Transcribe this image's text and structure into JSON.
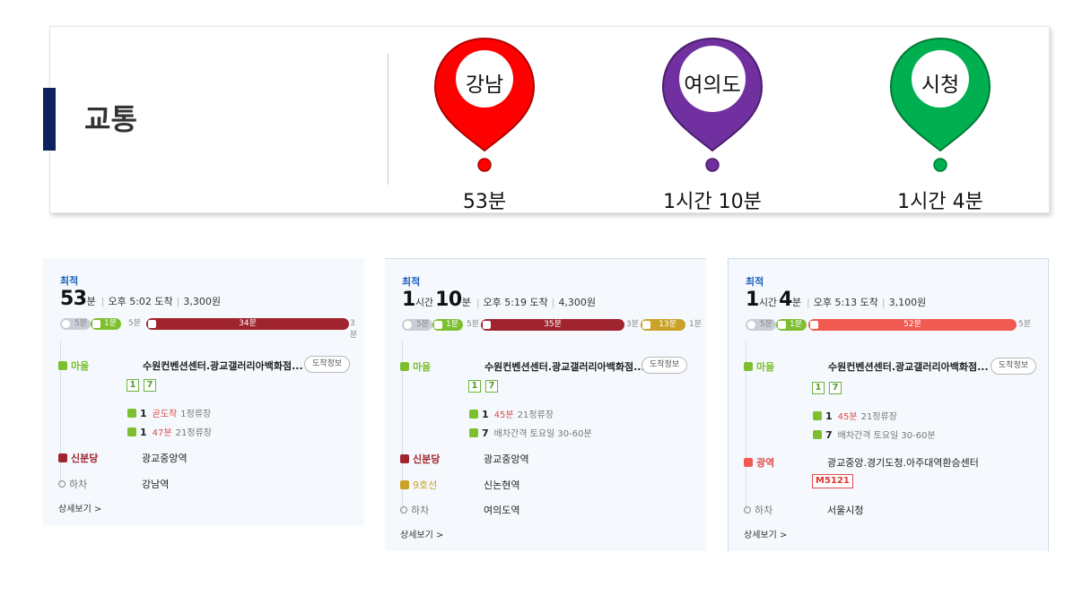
{
  "header": {
    "title": "교통"
  },
  "destinations": [
    {
      "name": "강남",
      "time": "53분",
      "color": "#ff0000",
      "dark": "#b00000"
    },
    {
      "name": "여의도",
      "time": "1시간 10분",
      "color": "#7030a0",
      "dark": "#4a1d6e"
    },
    {
      "name": "시청",
      "time": "1시간 4분",
      "color": "#00b050",
      "dark": "#007a36"
    }
  ],
  "common": {
    "best_label": "최적",
    "arrival_info": "도착정보",
    "more": "상세보기 >",
    "alight": "하차",
    "start_badge": "마을",
    "start_stop": "수원컨벤션센터.광교갤러리아백화점...",
    "routes": [
      "1",
      "7"
    ],
    "walk_first": "5분",
    "bus_first": "1분",
    "walk_second": "5분"
  },
  "cards": [
    {
      "summary": {
        "big1": "53",
        "unit1": "분",
        "big2": "",
        "unit2": "",
        "arrival": "오후 5:02 도착",
        "fare": "3,300원"
      },
      "bar": {
        "main": "34분",
        "tail": "3분",
        "transfer": ""
      },
      "buses": [
        {
          "num": "1",
          "status": "곧도착",
          "stops": "1정류장"
        },
        {
          "num": "1",
          "status": "47분",
          "stops": "21정류장"
        }
      ],
      "transfer": {
        "badge": "신분당",
        "name": "광교중앙역"
      },
      "transfer2": {
        "badge": "",
        "name": ""
      },
      "end": "강남역"
    },
    {
      "summary": {
        "big1": "1",
        "unit1": "시간",
        "big2": "10",
        "unit2": "분",
        "arrival": "오후 5:19 도착",
        "fare": "4,300원"
      },
      "bar": {
        "main": "35분",
        "tail": "3분",
        "transfer": "13분",
        "tail2": "1분"
      },
      "buses": [
        {
          "num": "1",
          "status": "45분",
          "stops": "21정류장"
        },
        {
          "num": "7",
          "status": "",
          "stops": "배차간격 토요일 30-60분"
        }
      ],
      "transfer": {
        "badge": "신분당",
        "name": "광교중앙역"
      },
      "transfer2": {
        "badge": "9호선",
        "name": "신논현역"
      },
      "end": "여의도역"
    },
    {
      "summary": {
        "big1": "1",
        "unit1": "시간",
        "big2": "4",
        "unit2": "분",
        "arrival": "오후 5:13 도착",
        "fare": "3,100원"
      },
      "bar": {
        "main": "52분",
        "tail": "5분",
        "transfer": ""
      },
      "buses": [
        {
          "num": "1",
          "status": "45분",
          "stops": "21정류장"
        },
        {
          "num": "7",
          "status": "",
          "stops": "배차간격 토요일 30-60분"
        }
      ],
      "transfer": {
        "badge": "광역",
        "name": "광교중앙.경기도청.아주대역환승센터"
      },
      "m_bus": "M5121",
      "transfer2": {
        "badge": "",
        "name": ""
      },
      "end": "서울시청"
    }
  ],
  "colors": {
    "village_bus": "#7dbf2f",
    "shinbundang": "#a0242e",
    "line9": "#c9a227",
    "express_bus": "#f15a50",
    "accent_navy": "#0d2060"
  }
}
